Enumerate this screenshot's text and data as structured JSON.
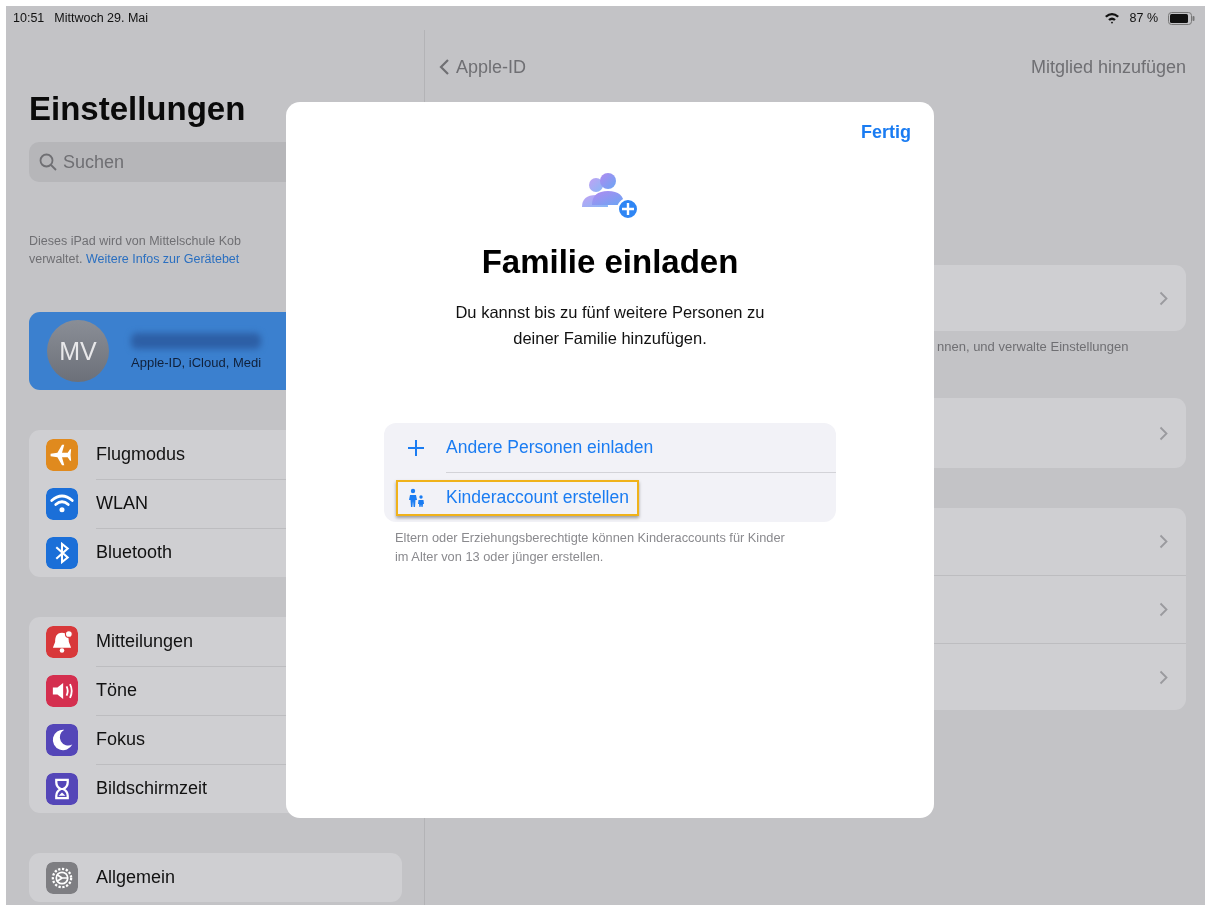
{
  "status_bar": {
    "time": "10:51",
    "date": "Mittwoch 29. Mai",
    "battery": "87 %"
  },
  "sidebar": {
    "title": "Einstellungen",
    "search": {
      "placeholder": "Suchen"
    },
    "note": "Dieses iPad wird von Mittelschule Kob",
    "note_line2": "verwaltet.",
    "note_link": "Weitere Infos zur Gerätebet",
    "profile": {
      "initials": "MV",
      "subtitle": "Apple-ID, iCloud, Medi",
      "selected": true
    },
    "groups": [
      [
        {
          "label": "Flugmodus",
          "color": "#e08a1e"
        },
        {
          "label": "WLAN",
          "color": "#1b6fd8"
        },
        {
          "label": "Bluetooth",
          "color": "#1b6fd8"
        }
      ],
      [
        {
          "label": "Mitteilungen",
          "color": "#d8383a"
        },
        {
          "label": "Töne",
          "color": "#d42f4f"
        },
        {
          "label": "Fokus",
          "color": "#5446b8"
        },
        {
          "label": "Bildschirmzeit",
          "color": "#5446b8"
        }
      ],
      [
        {
          "label": "Allgemein",
          "color": "#7e7e82"
        }
      ]
    ]
  },
  "detail": {
    "back": "Apple-ID",
    "action": "Mitglied hinzufügen",
    "action_disabled": true,
    "footer": "nnen, und verwalte Einstellungen"
  },
  "modal": {
    "done": "Fertig",
    "title": "Familie einladen",
    "description": "Du kannst bis zu fünf weitere Personen zu deiner Familie hinzufügen.",
    "options": [
      {
        "kind": "add",
        "label": "Andere Personen einladen",
        "highlighted": false
      },
      {
        "kind": "child",
        "label": "Kinderaccount erstellen",
        "highlighted": true
      }
    ],
    "footnote": "Eltern oder Erziehungsberechtigte können Kinderaccounts für Kinder im Alter von 13 oder jünger erstellen."
  }
}
